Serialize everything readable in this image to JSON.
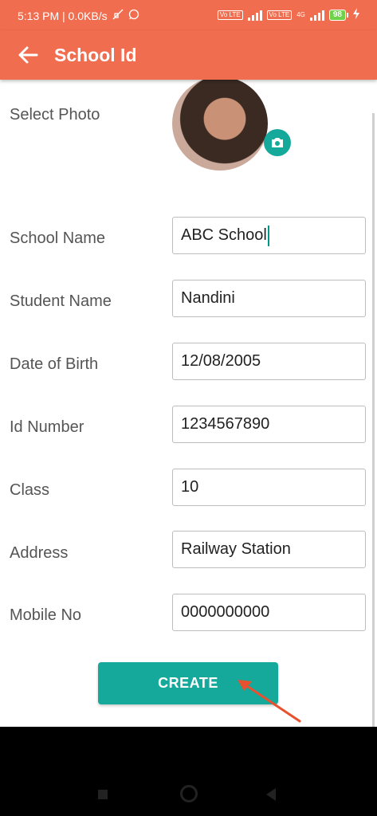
{
  "status_bar": {
    "time_speed": "5:13 PM | 0.0KB/s",
    "battery": "98",
    "volte1": "Vo LTE",
    "volte2": "Vo LTE",
    "network": "4G"
  },
  "app_bar": {
    "title": "School Id"
  },
  "photo": {
    "label": "Select Photo"
  },
  "form": {
    "school_name": {
      "label": "School Name",
      "value": "ABC School"
    },
    "student_name": {
      "label": "Student Name",
      "value": "Nandini"
    },
    "dob": {
      "label": "Date of Birth",
      "value": "12/08/2005"
    },
    "id_number": {
      "label": "Id Number",
      "value": "1234567890"
    },
    "class": {
      "label": "Class",
      "value": "10"
    },
    "address": {
      "label": "Address",
      "value": "Railway Station"
    },
    "mobile": {
      "label": "Mobile No",
      "value": "0000000000"
    }
  },
  "create_button": {
    "label": "CREATE"
  },
  "colors": {
    "primary": "#f06e4f",
    "accent": "#14a99a"
  }
}
